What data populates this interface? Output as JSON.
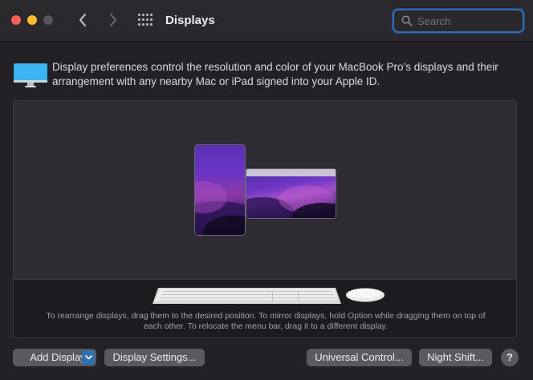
{
  "window": {
    "title": "Displays",
    "traffic_lights": [
      "close",
      "minimize",
      "zoom"
    ],
    "nav": {
      "back_icon": "chevron-left-icon",
      "forward_icon": "chevron-right-icon",
      "grid_icon": "show-all-grid-icon"
    }
  },
  "search": {
    "placeholder": "Search",
    "value": "",
    "icon": "search-icon"
  },
  "description": {
    "icon": "display-monitor-icon",
    "text": "Display preferences control the resolution and color of your MacBook Pro’s displays and their arrangement with any nearby Mac or iPad signed into your Apple ID."
  },
  "arrangement": {
    "displays": [
      "ipad-display",
      "macbook-display"
    ],
    "peripherals": [
      "keyboard",
      "mouse"
    ],
    "hint": "To rearrange displays, drag them to the desired position. To mirror displays, hold Option while dragging them on top of each other. To relocate the menu bar, drag it to a different display."
  },
  "buttons": {
    "add_display": "Add Display",
    "display_settings": "Display Settings...",
    "universal_control": "Universal Control...",
    "night_shift": "Night Shift...",
    "help": "?"
  },
  "colors": {
    "accent": "#2f6fb1",
    "close": "#ff5f57",
    "minimize": "#febc2e"
  }
}
